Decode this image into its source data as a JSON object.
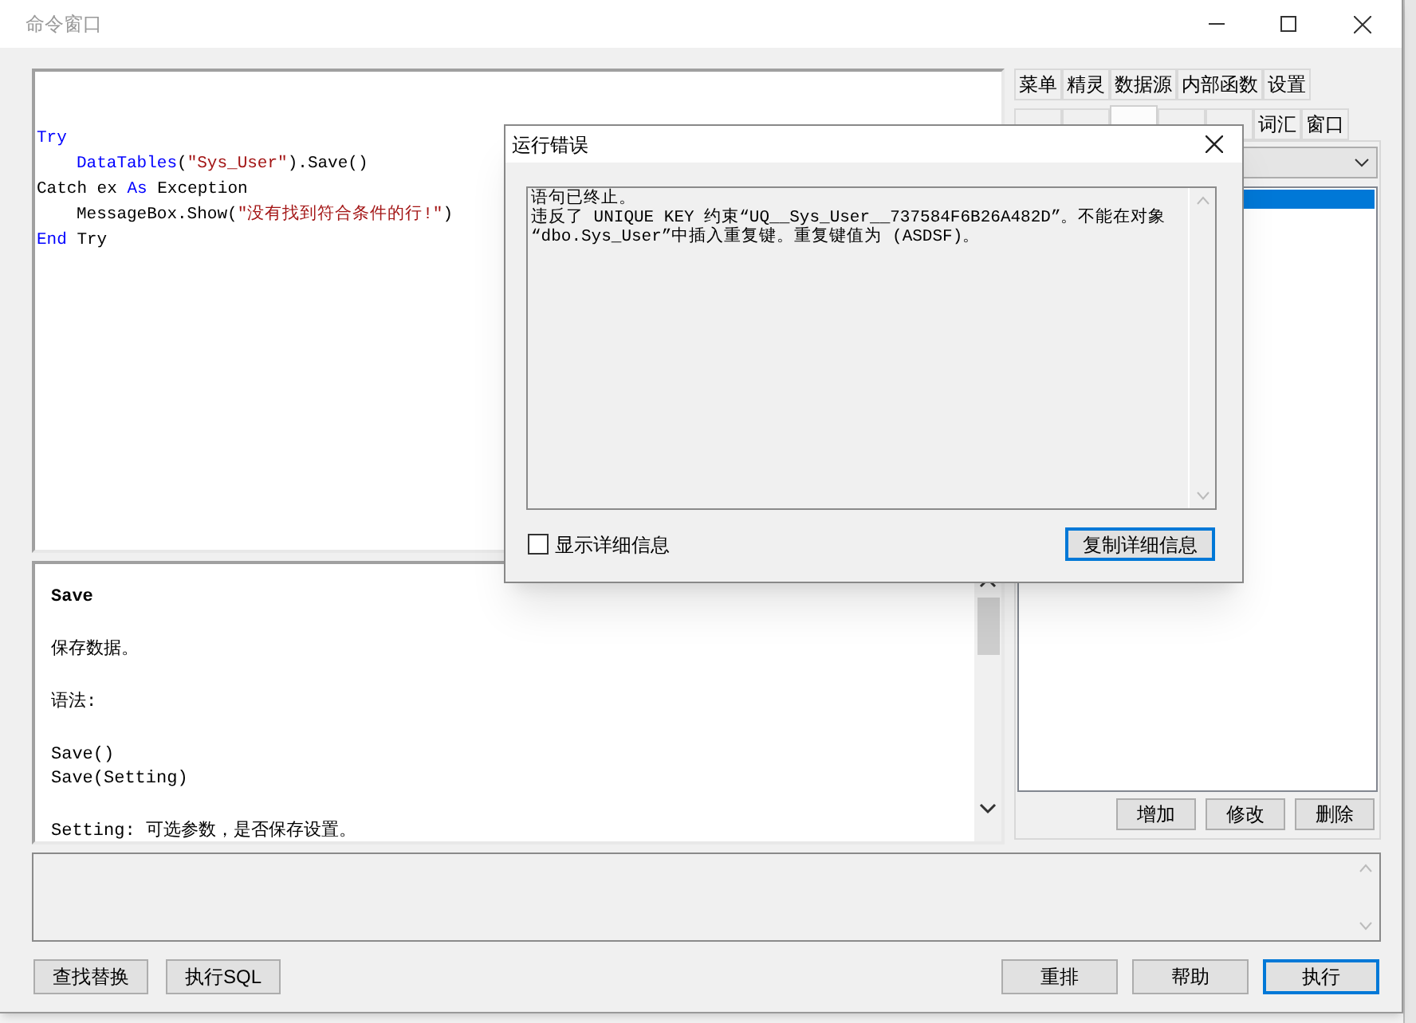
{
  "window": {
    "title": "命令窗口"
  },
  "code_editor": {
    "lines": [
      {
        "indent": false,
        "tokens": [
          {
            "kind": "keyword",
            "text": "Try"
          }
        ]
      },
      {
        "indent": true,
        "tokens": [
          {
            "kind": "keyword",
            "text": "DataTables"
          },
          {
            "kind": "plain",
            "text": "("
          },
          {
            "kind": "string",
            "text": "\"Sys_User\""
          },
          {
            "kind": "plain",
            "text": ").Save()"
          }
        ]
      },
      {
        "indent": false,
        "tokens": [
          {
            "kind": "plain",
            "text": "Catch ex "
          },
          {
            "kind": "keyword",
            "text": "As"
          },
          {
            "kind": "plain",
            "text": " Exception"
          }
        ]
      },
      {
        "indent": true,
        "tokens": [
          {
            "kind": "plain",
            "text": "MessageBox.Show("
          },
          {
            "kind": "string",
            "text": "\"没有找到符合条件的行!\""
          },
          {
            "kind": "plain",
            "text": ")"
          }
        ]
      },
      {
        "indent": false,
        "tokens": [
          {
            "kind": "keyword",
            "text": "End"
          },
          {
            "kind": "plain",
            "text": " Try"
          }
        ]
      }
    ]
  },
  "help_panel": {
    "paragraphs": [
      {
        "kind": "heading",
        "lines": [
          "Save"
        ]
      },
      {
        "kind": "text",
        "lines": [
          "保存数据。"
        ]
      },
      {
        "kind": "text",
        "lines": [
          "语法:"
        ]
      },
      {
        "kind": "text",
        "lines": [
          "Save()",
          "Save(Setting)"
        ]
      },
      {
        "kind": "text",
        "lines": [
          "Setting: 可选参数，是否保存设置。"
        ]
      }
    ]
  },
  "side_panel": {
    "tabs_row_1": [
      {
        "label": "菜单",
        "selected": false
      },
      {
        "label": "精灵",
        "selected": false
      },
      {
        "label": "数据源",
        "selected": false
      },
      {
        "label": "内部函数",
        "selected": false
      },
      {
        "label": "设置",
        "selected": false
      }
    ],
    "tabs_row_2": [
      {
        "selected": false
      },
      {
        "selected": false
      },
      {
        "selected": true
      },
      {
        "selected": false
      },
      {
        "selected": false
      },
      {
        "label": "词汇",
        "selected": false
      },
      {
        "label": "窗口",
        "selected": false
      }
    ],
    "list_items": [
      {
        "selected": true
      }
    ],
    "buttons": [
      "增加",
      "修改",
      "删除"
    ]
  },
  "bottom_buttons_left": [
    "查找替换",
    "执行SQL"
  ],
  "bottom_buttons_right": [
    {
      "label": "重排",
      "default": false
    },
    {
      "label": "帮助",
      "default": false
    },
    {
      "label": "执行",
      "default": true
    }
  ],
  "error_dialog": {
    "title": "运行错误",
    "message_lines": [
      "语句已终止。",
      "违反了 UNIQUE KEY 约束“UQ__Sys_User__737584F6B26A482D”。不能在对象",
      "“dbo.Sys_User”中插入重复键。重复键值为 (ASDSF)。"
    ],
    "checkbox": {
      "label": "显示详细信息",
      "checked": false
    },
    "button": {
      "label": "复制详细信息",
      "focused": true
    }
  }
}
